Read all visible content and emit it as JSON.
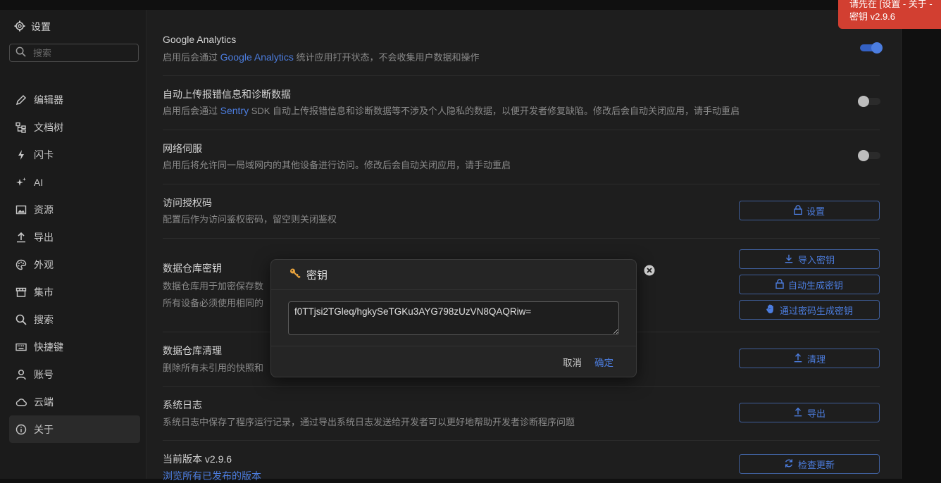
{
  "sidebar": {
    "title": "设置",
    "search_placeholder": "搜索",
    "items": [
      {
        "label": "编辑器",
        "icon": "pencil-icon"
      },
      {
        "label": "文档树",
        "icon": "tree-icon"
      },
      {
        "label": "闪卡",
        "icon": "lightning-icon"
      },
      {
        "label": "AI",
        "icon": "sparkle-icon"
      },
      {
        "label": "资源",
        "icon": "image-icon"
      },
      {
        "label": "导出",
        "icon": "upload-icon"
      },
      {
        "label": "外观",
        "icon": "palette-icon"
      },
      {
        "label": "集市",
        "icon": "store-icon"
      },
      {
        "label": "搜索",
        "icon": "search-icon"
      },
      {
        "label": "快捷键",
        "icon": "keyboard-icon"
      },
      {
        "label": "账号",
        "icon": "user-icon"
      },
      {
        "label": "云端",
        "icon": "cloud-icon"
      },
      {
        "label": "关于",
        "icon": "info-icon",
        "active": true
      }
    ]
  },
  "settings": {
    "ga": {
      "title": "Google Analytics",
      "desc_pre": "启用后会通过 ",
      "desc_link": "Google Analytics",
      "desc_post": " 统计应用打开状态，不会收集用户数据和操作",
      "enabled": true
    },
    "sentry": {
      "title": "自动上传报错信息和诊断数据",
      "desc_pre": "启用后会通过 ",
      "desc_link": "Sentry",
      "desc_post": " SDK 自动上传报错信息和诊断数据等不涉及个人隐私的数据，以便开发者修复缺陷。修改后会自动关闭应用，请手动重启",
      "enabled": false
    },
    "network": {
      "title": "网络伺服",
      "desc": "启用后将允许同一局域网内的其他设备进行访问。修改后会自动关闭应用，请手动重启",
      "enabled": false
    },
    "auth": {
      "title": "访问授权码",
      "desc": "配置后作为访问鉴权密码，留空则关闭鉴权",
      "button": "设置"
    },
    "repo_key": {
      "title": "数据仓库密钥",
      "desc": "数据仓库用于加密保存数",
      "warning": "所有设备必须使用相同的",
      "buttons": [
        "导入密钥",
        "自动生成密钥",
        "通过密码生成密钥"
      ]
    },
    "repo_clean": {
      "title": "数据仓库清理",
      "desc": "删除所有未引用的快照和",
      "button": "清理"
    },
    "log": {
      "title": "系统日志",
      "desc": "系统日志中保存了程序运行记录，通过导出系统日志发送给开发者可以更好地帮助开发者诊断程序问题",
      "button": "导出"
    },
    "version": {
      "title": "当前版本 v2.9.6",
      "link": "浏览所有已发布的版本",
      "button": "检查更新"
    }
  },
  "toast": {
    "line1": "请先在 [设置 - 关于 - ",
    "line2": "密钥 v2.9.6"
  },
  "dialog": {
    "title": "密钥",
    "value": "f0TTjsi2TGleq/hgkySeTGKu3AYG798zUzVN8QAQRiw=",
    "cancel": "取消",
    "ok": "确定"
  },
  "colors": {
    "accent": "#4c7ddf",
    "toast": "#d23f31",
    "background": "#1e1e1e"
  }
}
